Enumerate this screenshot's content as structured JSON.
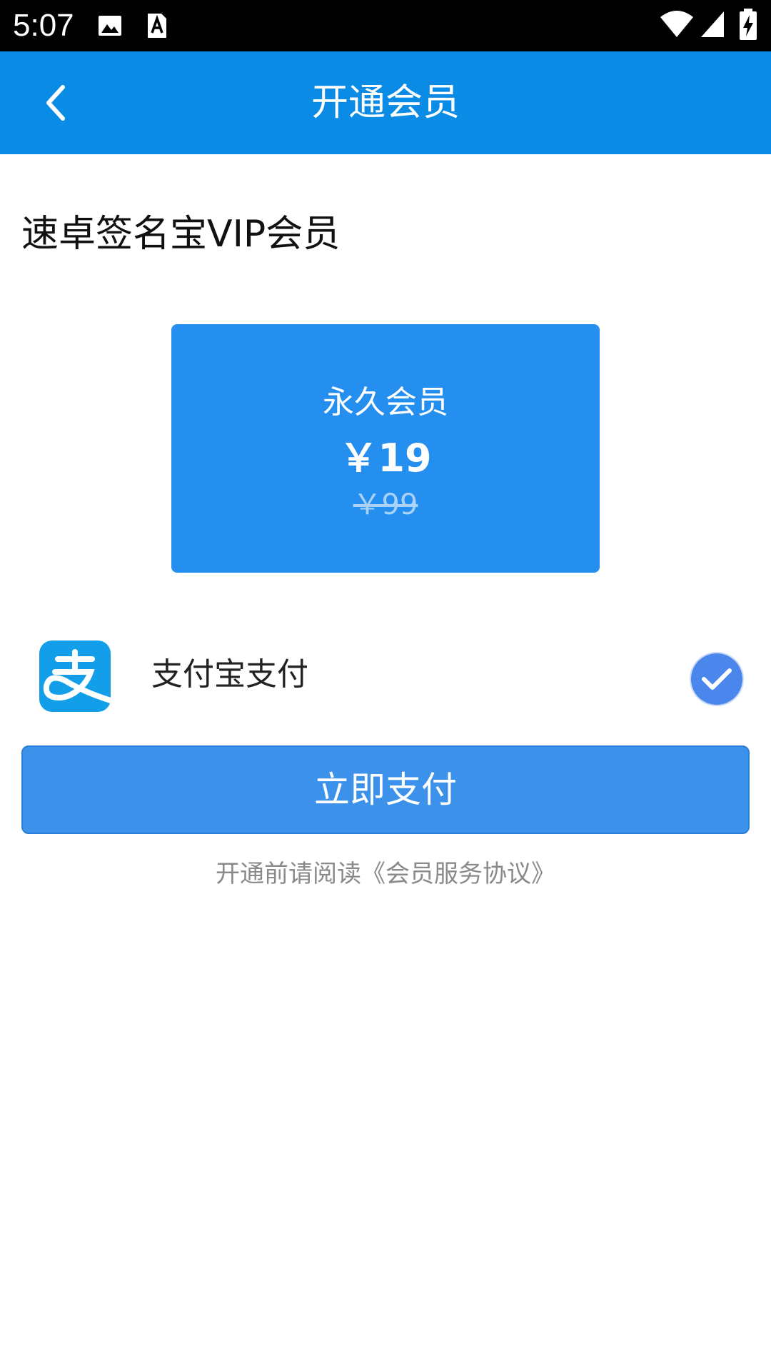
{
  "status_bar": {
    "time": "5:07",
    "icons": [
      "image-notification-icon",
      "a-badge-notification-icon",
      "wifi-icon",
      "cellular-signal-icon",
      "battery-charging-icon"
    ]
  },
  "app_bar": {
    "title": "开通会员",
    "back_icon": "back-chevron-icon",
    "color": "#0a8be6"
  },
  "section": {
    "title": "速卓签名宝VIP会员"
  },
  "plan": {
    "name": "永久会员",
    "price": "￥19",
    "original_price": "￥99",
    "color": "#258ff0"
  },
  "payment": {
    "method_label": "支付宝支付",
    "logo_icon": "alipay-logo-icon",
    "selected": true,
    "check_icon": "check-circle-icon"
  },
  "actions": {
    "pay_label": "立即支付"
  },
  "agreement": {
    "prefix": "开通前请阅读",
    "link": "《会员服务协议》"
  }
}
